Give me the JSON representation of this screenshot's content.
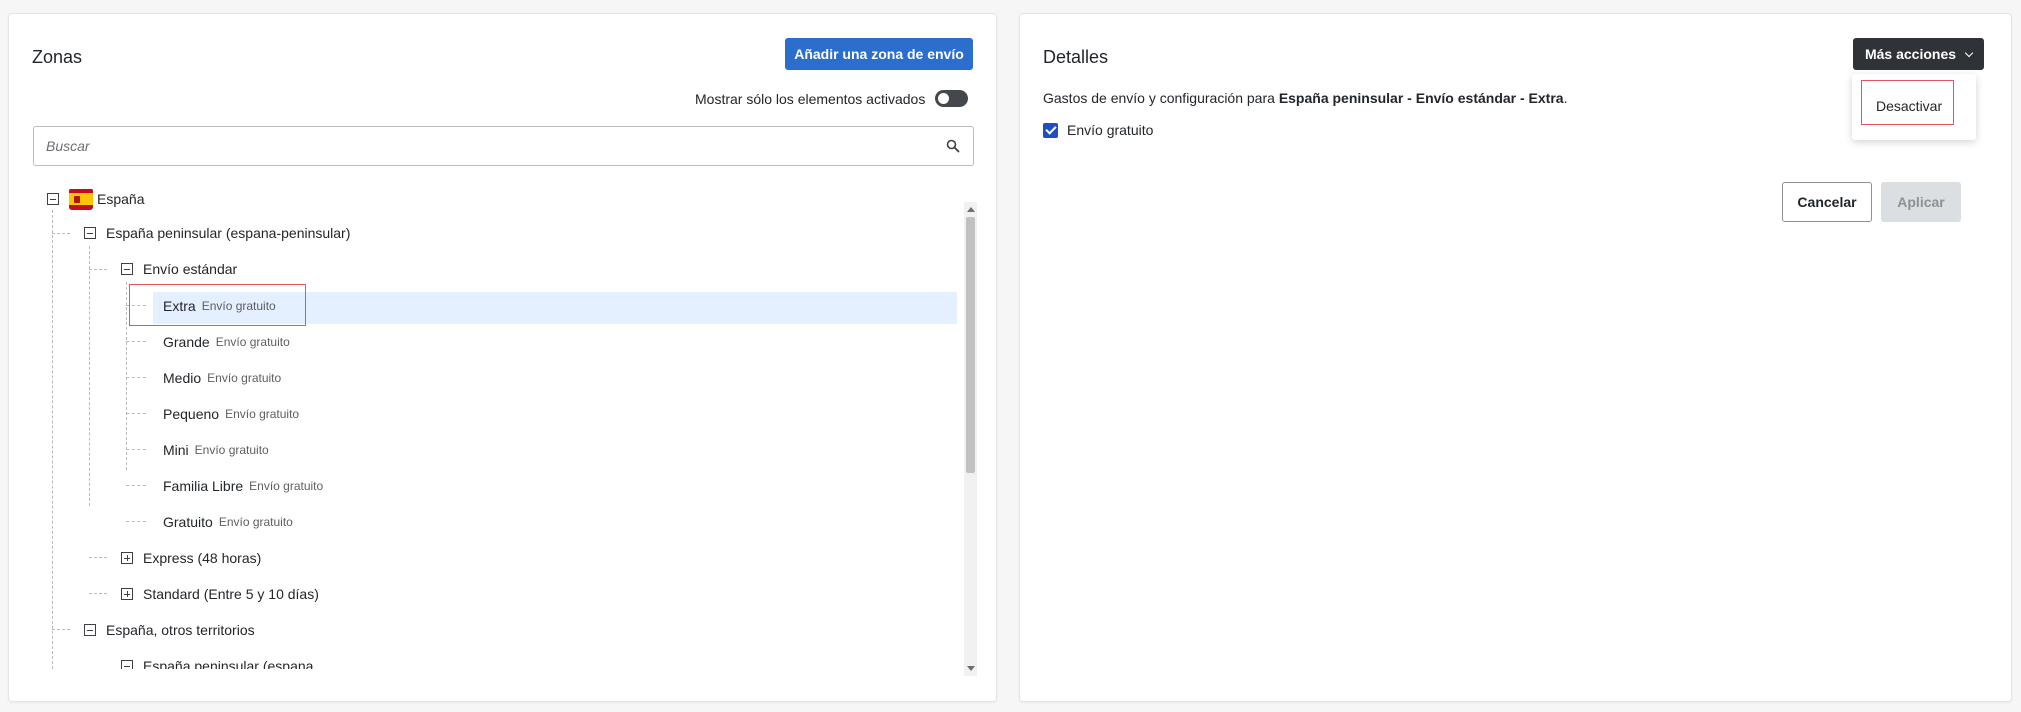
{
  "zones": {
    "title": "Zonas",
    "add_button": "Añadir una zona de envío",
    "toggle_label": "Mostrar sólo los elementos activados",
    "search_placeholder": "Buscar",
    "tree": {
      "root": "España",
      "peninsular": "España peninsular (espana-peninsular)",
      "envio_estandar": "Envío estándar",
      "items": [
        {
          "name": "Extra",
          "sub": "Envío gratuito"
        },
        {
          "name": "Grande",
          "sub": "Envío gratuito"
        },
        {
          "name": "Medio",
          "sub": "Envío gratuito"
        },
        {
          "name": "Pequeno",
          "sub": "Envío gratuito"
        },
        {
          "name": "Mini",
          "sub": "Envío gratuito"
        },
        {
          "name": "Familia Libre",
          "sub": "Envío gratuito"
        },
        {
          "name": "Gratuito",
          "sub": "Envío gratuito"
        }
      ],
      "express": "Express (48 horas)",
      "standard": "Standard (Entre 5 y 10 días)",
      "otros": "España, otros territorios",
      "cut_off": "España peninsular (espana"
    }
  },
  "details": {
    "title": "Detalles",
    "more_actions": "Más acciones",
    "menu_item_deactivate": "Desactivar",
    "desc_prefix": "Gastos de envío y configuración para ",
    "desc_bold": "España peninsular - Envío estándar  - Extra",
    "desc_suffix": ".",
    "free_shipping_label": "Envío gratuito",
    "cancel": "Cancelar",
    "apply": "Aplicar"
  },
  "colors": {
    "primary": "#2c6ecb",
    "dark_button": "#2f3337",
    "selection": "#e4efff",
    "highlight": "#e0565b"
  }
}
